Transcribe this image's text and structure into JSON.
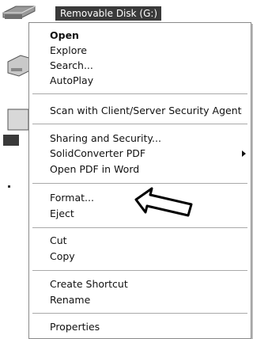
{
  "header": {
    "selected_drive_label": "Removable Disk (G:)"
  },
  "context_menu": {
    "groups": [
      [
        "Open",
        "Explore",
        "Search...",
        "AutoPlay"
      ],
      [
        "Scan with Client/Server Security Agent"
      ],
      [
        "Sharing and Security...",
        "SolidConverter PDF",
        "Open PDF in Word"
      ],
      [
        "Format...",
        "Eject"
      ],
      [
        "Cut",
        "Copy"
      ],
      [
        "Create Shortcut",
        "Rename"
      ],
      [
        "Properties"
      ]
    ]
  },
  "icons": {
    "drive": "removable-drive-icon",
    "submenu": "submenu-arrow-icon",
    "pointer": "arrow-pointer-icon"
  }
}
